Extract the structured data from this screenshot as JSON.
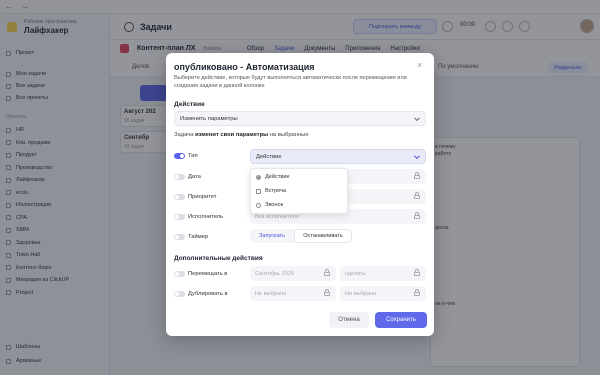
{
  "browser": {
    "back": "←",
    "forward": "→"
  },
  "sidebar": {
    "workspace_label": "Рабочие пространства",
    "workspace_name": "Лайфхакер",
    "project_item": "Проект",
    "items": [
      "Мои задачи",
      "Все задачи",
      "Все проекты"
    ],
    "projects_header": "Проекты",
    "projects": [
      "HR",
      "Кпи. продажи",
      "Продукт",
      "Производство",
      "Лайфхакер",
      "ecdu",
      "Иллюстрации",
      "CPA",
      "SMM",
      "Здоровье",
      "Town Hall",
      "Контент-бюро",
      "Миграция из ClickUP",
      "Project"
    ],
    "footer": [
      "Шаблоны",
      "Архивные"
    ]
  },
  "topbar": {
    "section_title": "Задачи",
    "command_button": "Подсказать команду",
    "timer": "00:00"
  },
  "project": {
    "title": "Контент-план ЛХ",
    "tag": "Взайлік",
    "tabs": [
      "Обзор",
      "Задачи",
      "Документы",
      "Приложения",
      "Настройки"
    ],
    "active_tab": "Задачи"
  },
  "toolbar": {
    "left_label": "Делов",
    "sort_label": "По умолчанию",
    "right_button": "Раздельно"
  },
  "board": {
    "months": [
      {
        "title": "Август 202",
        "sub": "16 задач"
      },
      {
        "title": "Сентябр",
        "sub": "16 задач"
      }
    ],
    "right_fragments": [
      "в почему",
      "работу",
      "досок,",
      "ии и чем"
    ]
  },
  "modal": {
    "title": "опубликовано - Автоматизация",
    "close": "×",
    "description": "Выберите действие, которые будут выполняться автоматически после перемещения или создания задачи в данной колонке",
    "action_header": "Действие",
    "action_value": "Изменить параметры",
    "hint_prefix": "Задача",
    "hint_bold": "изменит свои параметры",
    "hint_suffix": "на выбранные",
    "rows": [
      {
        "label": "Тип",
        "value": "Действие",
        "on": true
      },
      {
        "label": "Дата",
        "value": "",
        "on": false
      },
      {
        "label": "Приоритет",
        "value": "",
        "on": false
      },
      {
        "label": "Исполнитель",
        "value": "Без исполнителя",
        "on": false
      },
      {
        "label": "Таймер",
        "value": "",
        "on": false
      }
    ],
    "type_options": [
      "Действие",
      "Встреча",
      "Звонок"
    ],
    "timer_options": {
      "start": "Запускать",
      "stop": "Останавливать"
    },
    "extra_header": "Дополнительные действия",
    "extra_rows": [
      {
        "label": "Перемещать в",
        "left": "Сентябрь 2025",
        "right": "сделать"
      },
      {
        "label": "Дублировать в",
        "left": "Не выбрано",
        "right": "Не выбрано"
      }
    ],
    "cancel": "Отмена",
    "save": "Сохранить"
  },
  "colors": {
    "accent": "#5b64e8",
    "project": "#e0455a",
    "overlay": "rgba(30,34,45,0.48)"
  }
}
